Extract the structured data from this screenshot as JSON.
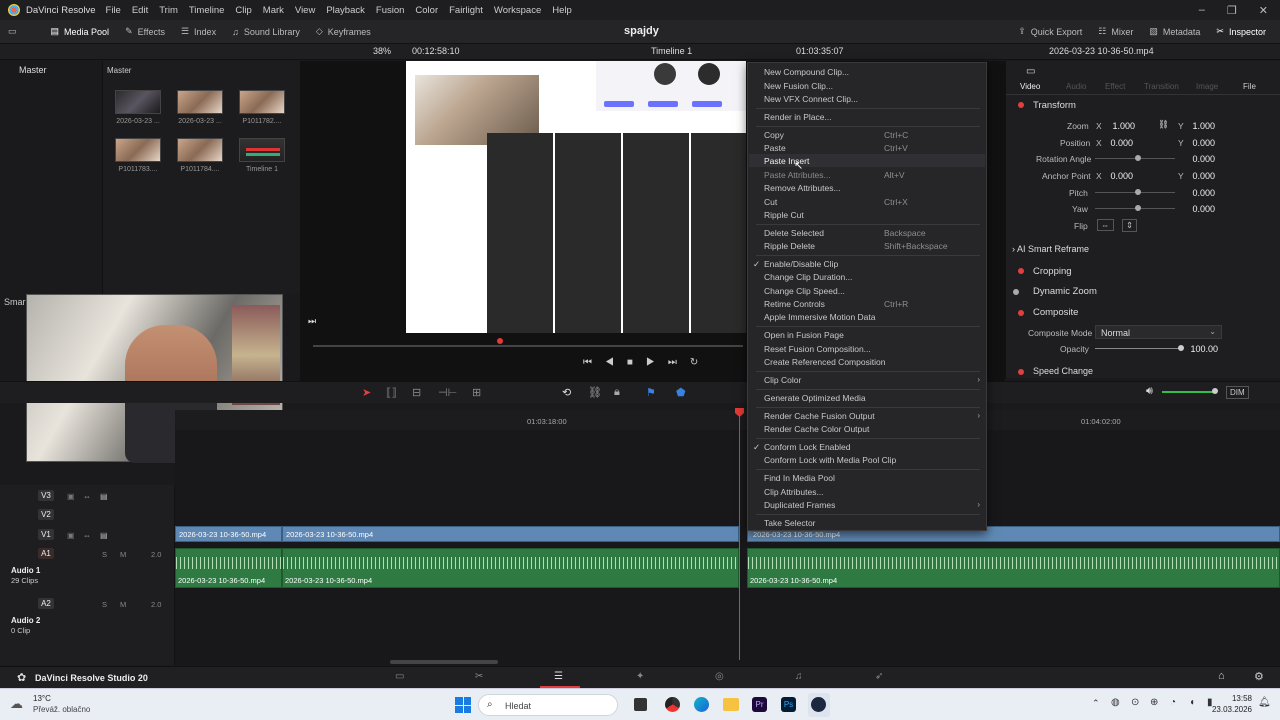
{
  "menubar": {
    "app_name": "DaVinci Resolve",
    "items": [
      "File",
      "Edit",
      "Trim",
      "Timeline",
      "Clip",
      "Mark",
      "View",
      "Playback",
      "Fusion",
      "Color",
      "Fairlight",
      "Workspace",
      "Help"
    ]
  },
  "toolbar": {
    "project_title": "spajdy",
    "media_pool": "Media Pool",
    "effects": "Effects",
    "index": "Index",
    "sound_library": "Sound Library",
    "keyframes": "Keyframes",
    "quick_export": "Quick Export",
    "mixer": "Mixer",
    "metadata": "Metadata",
    "inspector": "Inspector"
  },
  "subbar": {
    "zoom": "38%",
    "source_timecode": "00:12:58:10",
    "timeline_name": "Timeline 1",
    "record_timecode": "01:03:35:07",
    "inspector_clip": "2026-03-23 10-36-50.mp4"
  },
  "media_pool": {
    "bin_master": "Master",
    "header": "Master",
    "smart_bins": "Smar",
    "clips": [
      "2026-03-23 ...",
      "2026-03-23 ...",
      "P1011782....",
      "P1011783....",
      "P1011784....",
      "Timeline 1"
    ]
  },
  "inspector": {
    "tabs": [
      "Video",
      "Audio",
      "Effect",
      "Transition",
      "Image",
      "File"
    ],
    "transform": "Transform",
    "zoom_label": "Zoom",
    "zoom_x": "1.000",
    "zoom_y": "1.000",
    "position_label": "Position",
    "position_x": "0.000",
    "position_y": "0.000",
    "rotation_label": "Rotation Angle",
    "rotation": "0.000",
    "anchor_label": "Anchor Point",
    "anchor_x": "0.000",
    "anchor_y": "0.000",
    "pitch_label": "Pitch",
    "pitch": "0.000",
    "yaw_label": "Yaw",
    "yaw": "0.000",
    "flip_label": "Flip",
    "smart_reframe": "AI Smart Reframe",
    "cropping": "Cropping",
    "dynamic_zoom": "Dynamic Zoom",
    "composite": "Composite",
    "composite_mode_label": "Composite Mode",
    "composite_mode": "Normal",
    "opacity_label": "Opacity",
    "opacity": "100.00",
    "speed_change": "Speed Change"
  },
  "timeline": {
    "ruler_1": "01:03:18:00",
    "ruler_2": "01:04:02:00",
    "dim": "DIM",
    "tracks": {
      "v3": "V3",
      "v2": "V2",
      "v1": "V1",
      "a1": "A1",
      "a2": "A2",
      "a1_level": "2.0",
      "a2_level": "2.0",
      "audio1_name": "Audio 1",
      "audio1_clips": "29 Clips",
      "audio2_name": "Audio 2",
      "audio2_clips": "0 Clip"
    },
    "clip_name": "2026-03-23 10-36-50.mp4"
  },
  "context_menu": {
    "new_compound": "New Compound Clip...",
    "new_fusion": "New Fusion Clip...",
    "new_vfx": "New VFX Connect Clip...",
    "render_in_place": "Render in Place...",
    "copy": "Copy",
    "copy_key": "Ctrl+C",
    "paste": "Paste",
    "paste_key": "Ctrl+V",
    "paste_insert": "Paste Insert",
    "paste_attributes": "Paste Attributes...",
    "paste_attributes_key": "Alt+V",
    "remove_attributes": "Remove Attributes...",
    "cut": "Cut",
    "cut_key": "Ctrl+X",
    "ripple_cut": "Ripple Cut",
    "delete_selected": "Delete Selected",
    "delete_key": "Backspace",
    "ripple_delete": "Ripple Delete",
    "ripple_delete_key": "Shift+Backspace",
    "enable_disable": "Enable/Disable Clip",
    "change_duration": "Change Clip Duration...",
    "change_speed": "Change Clip Speed...",
    "retime_controls": "Retime Controls",
    "retime_key": "Ctrl+R",
    "immersive": "Apple Immersive Motion Data",
    "open_fusion": "Open in Fusion Page",
    "reset_fusion": "Reset Fusion Composition...",
    "create_ref": "Create Referenced Composition",
    "clip_color": "Clip Color",
    "gen_optimized": "Generate Optimized Media",
    "render_cache_fusion": "Render Cache Fusion Output",
    "render_cache_color": "Render Cache Color Output",
    "conform_lock": "Conform Lock Enabled",
    "conform_lock_mp": "Conform Lock with Media Pool Clip",
    "find_in_mp": "Find In Media Pool",
    "clip_attributes": "Clip Attributes...",
    "duplicated_frames": "Duplicated Frames",
    "take_selector": "Take Selector"
  },
  "pagebar": {
    "product": "DaVinci Resolve Studio 20"
  },
  "taskbar": {
    "temp": "13°C",
    "weather": "Převáž. oblačno",
    "search": "Hledat",
    "time": "13:58",
    "date": "23.03.2026"
  },
  "colors": {
    "accent": "#e04040",
    "video_clip": "#5f89b4",
    "audio_clip": "#2f7a43",
    "playhead": "#e53935"
  }
}
